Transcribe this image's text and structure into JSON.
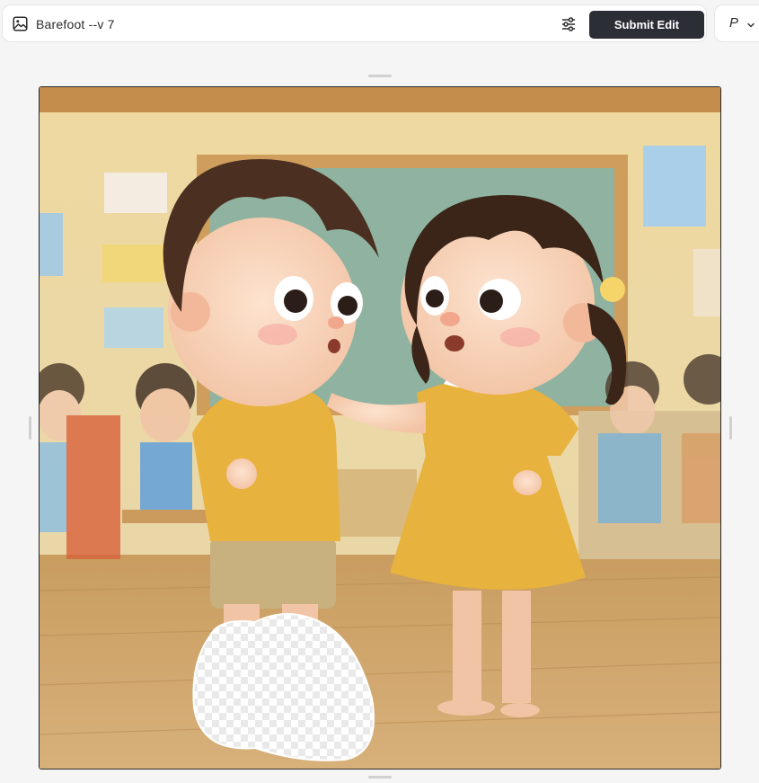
{
  "toolbar": {
    "prompt_text": "Barefoot --v 7",
    "submit_label": "Submit Edit",
    "model_label": "P",
    "prompt_icon": "image-icon",
    "settings_icon": "sliders-icon",
    "chevron_icon": "chevron-down-icon",
    "submit_color": "#2b2e35"
  },
  "canvas": {
    "image_description_icon": "edit-canvas",
    "erased_region": "transparent-checkerboard"
  }
}
